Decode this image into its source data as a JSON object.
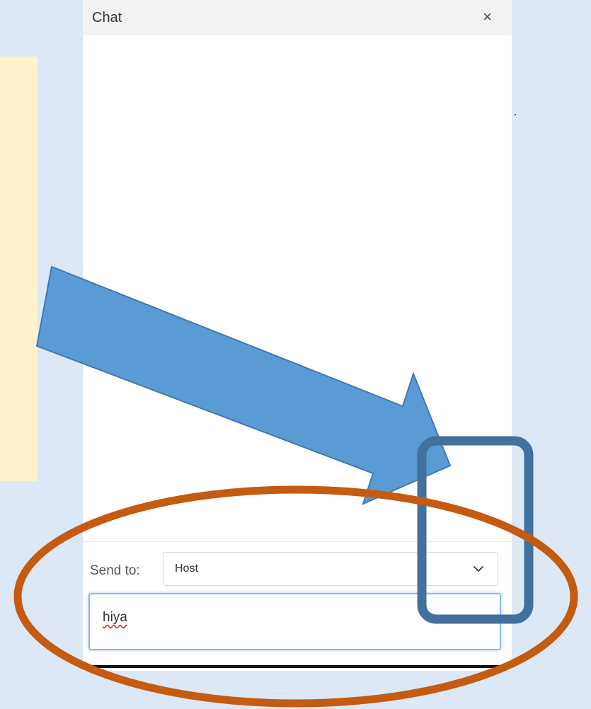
{
  "chat": {
    "title": "Chat",
    "close_label": "×",
    "send_to_label": "Send to:",
    "recipient": "Host",
    "message_value": "hiya"
  },
  "icons": {
    "close": "close-icon",
    "dropdown": "chevron-down-icon"
  },
  "annotations": {
    "arrow_color": "#5b9bd5",
    "rectangle_color": "#41719c",
    "ellipse_color": "#c55a11"
  },
  "colors": {
    "background": "#dce8f6",
    "note_panel": "#fff2cc",
    "header_bg": "#f2f2f2",
    "input_focus": "#8db6ef"
  }
}
